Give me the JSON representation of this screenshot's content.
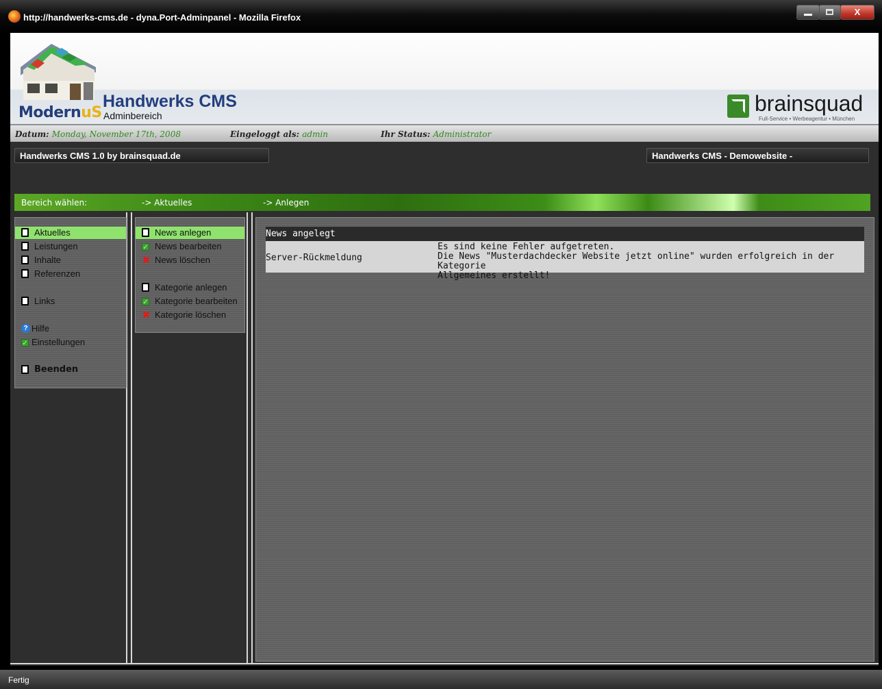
{
  "window": {
    "title": "http://handwerks-cms.de - dyna.Port-Adminpanel - Mozilla Firefox",
    "close_glyph": "X"
  },
  "header": {
    "logo_text_a": "Modern",
    "logo_text_b": "uS",
    "title": "Handwerks CMS",
    "subtitle": "Adminbereich",
    "brand": "brainsquad",
    "brand_tagline": "Full-Service • Werbeagentur • München"
  },
  "infobar": {
    "date_label": "Datum:",
    "date_value": "Monday, November 17th, 2008",
    "login_label": "Eingeloggt als:",
    "login_value": "admin",
    "status_label": "Ihr Status:",
    "status_value": "Administrator"
  },
  "pills": {
    "left": "Handwerks CMS 1.0 by brainsquad.de",
    "right": "Handwerks CMS - Demowebsite -"
  },
  "breadcrumb": {
    "section": "Bereich wählen:",
    "area": "-> Aktuelles",
    "action": "-> Anlegen"
  },
  "menu": {
    "items": [
      {
        "label": "Aktuelles",
        "icon": "document-icon",
        "selected": true
      },
      {
        "label": "Leistungen",
        "icon": "document-icon"
      },
      {
        "label": "Inhalte",
        "icon": "document-icon"
      },
      {
        "label": "Referenzen",
        "icon": "document-icon"
      },
      {
        "label": "Links",
        "icon": "document-icon"
      },
      {
        "label": "Hilfe",
        "icon": "help-icon"
      },
      {
        "label": "Einstellungen",
        "icon": "checkbox-icon"
      },
      {
        "label": "Beenden",
        "icon": "document-icon"
      }
    ]
  },
  "submenu": {
    "items": [
      {
        "label": "News anlegen",
        "icon": "document-icon",
        "selected": true
      },
      {
        "label": "News bearbeiten",
        "icon": "checkbox-icon"
      },
      {
        "label": "News löschen",
        "icon": "delete-icon"
      },
      {
        "label": "Kategorie anlegen",
        "icon": "document-icon"
      },
      {
        "label": "Kategorie bearbeiten",
        "icon": "checkbox-icon"
      },
      {
        "label": "Kategorie löschen",
        "icon": "delete-icon"
      }
    ]
  },
  "message": {
    "heading": "News angelegt",
    "key": "Server-Rückmeldung",
    "line1": "Es sind keine Fehler aufgetreten.",
    "line2": "Die News \"Musterdachdecker Website jetzt online\" wurden erfolgreich in der Kategorie",
    "line3": "Allgemeines erstellt!"
  },
  "statusbar": {
    "text": "Fertig"
  }
}
